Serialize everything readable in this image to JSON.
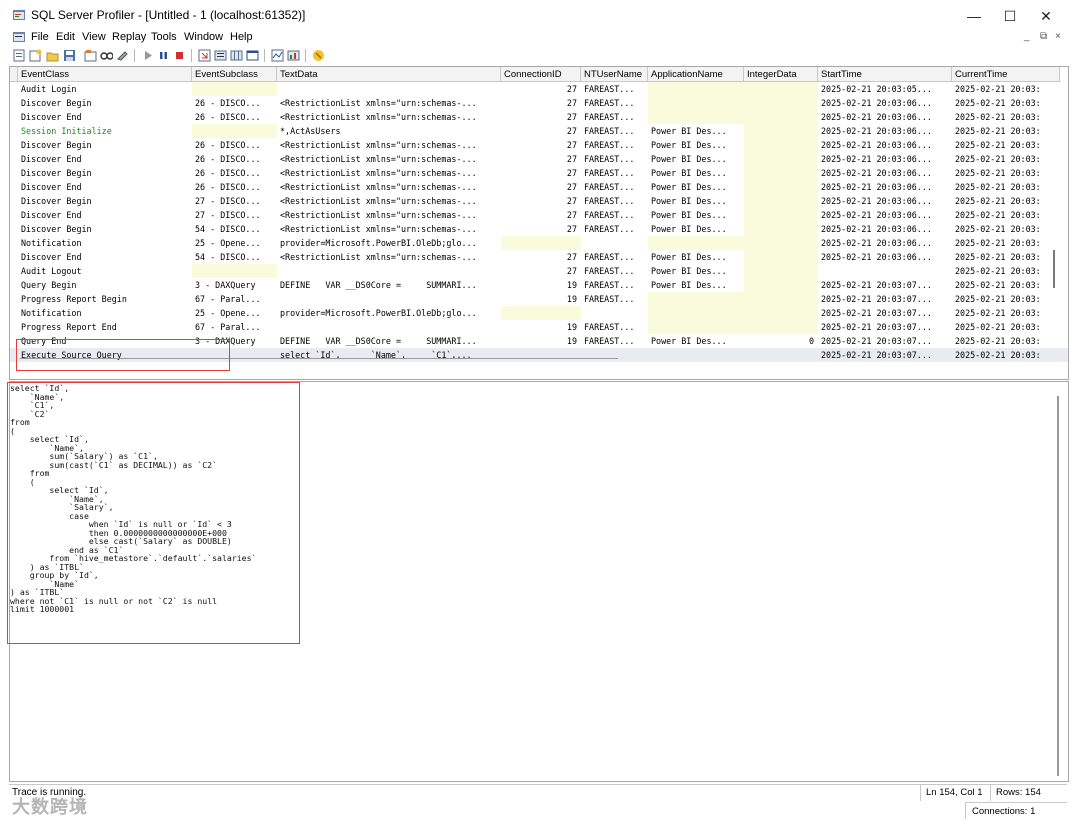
{
  "window": {
    "title": "SQL Server Profiler - [Untitled - 1 (localhost:61352)]",
    "minimize": "—",
    "maximize": "☐",
    "close": "✕"
  },
  "menu": {
    "items": [
      "File",
      "Edit",
      "View",
      "Replay",
      "Tools",
      "Window",
      "Help"
    ],
    "mdi_minimize": "_",
    "mdi_restore": "⧉",
    "mdi_close": "×"
  },
  "toolbar": {
    "icons": [
      "new-trace-icon",
      "new-template-icon",
      "open-icon",
      "save-icon",
      "properties-icon",
      "find-icon",
      "clear-icon",
      "start-icon",
      "pause-icon",
      "stop-icon",
      "scroll-icon",
      "columns-icon",
      "filter-icon",
      "window-icon",
      "perfmon-icon",
      "chart-icon",
      "help-icon"
    ]
  },
  "grid": {
    "columns": [
      "EventClass",
      "EventSubclass",
      "TextData",
      "ConnectionID",
      "NTUserName",
      "ApplicationName",
      "IntegerData",
      "StartTime",
      "CurrentTime"
    ],
    "rows": [
      [
        "Audit Login",
        "",
        "",
        "27",
        "FAREAST...",
        "",
        "",
        "2025-02-21 20:03:05...",
        "2025-02-21 20:03:"
      ],
      [
        "Discover Begin",
        "26 - DISCO...",
        "<RestrictionList xmlns=\"urn:schemas-...",
        "27",
        "FAREAST...",
        "",
        "",
        "2025-02-21 20:03:06...",
        "2025-02-21 20:03:"
      ],
      [
        "Discover End",
        "26 - DISCO...",
        "<RestrictionList xmlns=\"urn:schemas-...",
        "27",
        "FAREAST...",
        "",
        "",
        "2025-02-21 20:03:06...",
        "2025-02-21 20:03:"
      ],
      [
        "Session Initialize",
        "",
        "*,ActAsUsers",
        "27",
        "FAREAST...",
        "Power BI Des...",
        "",
        "2025-02-21 20:03:06...",
        "2025-02-21 20:03:"
      ],
      [
        "Discover Begin",
        "26 - DISCO...",
        "<RestrictionList xmlns=\"urn:schemas-...",
        "27",
        "FAREAST...",
        "Power BI Des...",
        "",
        "2025-02-21 20:03:06...",
        "2025-02-21 20:03:"
      ],
      [
        "Discover End",
        "26 - DISCO...",
        "<RestrictionList xmlns=\"urn:schemas-...",
        "27",
        "FAREAST...",
        "Power BI Des...",
        "",
        "2025-02-21 20:03:06...",
        "2025-02-21 20:03:"
      ],
      [
        "Discover Begin",
        "26 - DISCO...",
        "<RestrictionList xmlns=\"urn:schemas-...",
        "27",
        "FAREAST...",
        "Power BI Des...",
        "",
        "2025-02-21 20:03:06...",
        "2025-02-21 20:03:"
      ],
      [
        "Discover End",
        "26 - DISCO...",
        "<RestrictionList xmlns=\"urn:schemas-...",
        "27",
        "FAREAST...",
        "Power BI Des...",
        "",
        "2025-02-21 20:03:06...",
        "2025-02-21 20:03:"
      ],
      [
        "Discover Begin",
        "27 - DISCO...",
        "<RestrictionList xmlns=\"urn:schemas-...",
        "27",
        "FAREAST...",
        "Power BI Des...",
        "",
        "2025-02-21 20:03:06...",
        "2025-02-21 20:03:"
      ],
      [
        "Discover End",
        "27 - DISCO...",
        "<RestrictionList xmlns=\"urn:schemas-...",
        "27",
        "FAREAST...",
        "Power BI Des...",
        "",
        "2025-02-21 20:03:06...",
        "2025-02-21 20:03:"
      ],
      [
        "Discover Begin",
        "54 - DISCO...",
        "<RestrictionList xmlns=\"urn:schemas-...",
        "27",
        "FAREAST...",
        "Power BI Des...",
        "",
        "2025-02-21 20:03:06...",
        "2025-02-21 20:03:"
      ],
      [
        "Notification",
        "25 - Opene...",
        "provider=Microsoft.PowerBI.OleDb;glo...",
        "",
        "",
        "",
        "",
        "2025-02-21 20:03:06...",
        "2025-02-21 20:03:"
      ],
      [
        "Discover End",
        "54 - DISCO...",
        "<RestrictionList xmlns=\"urn:schemas-...",
        "27",
        "FAREAST...",
        "Power BI Des...",
        "",
        "2025-02-21 20:03:06...",
        "2025-02-21 20:03:"
      ],
      [
        "Audit Logout",
        "",
        "",
        "27",
        "FAREAST...",
        "Power BI Des...",
        "",
        "",
        "2025-02-21 20:03:"
      ],
      [
        "Query Begin",
        "3 - DAXQuery",
        "DEFINE   VAR __DS0Core =     SUMMARI...",
        "19",
        "FAREAST...",
        "Power BI Des...",
        "",
        "2025-02-21 20:03:07...",
        "2025-02-21 20:03:"
      ],
      [
        "Progress Report Begin",
        "67 - Paral...",
        "",
        "19",
        "FAREAST...",
        "",
        "",
        "2025-02-21 20:03:07...",
        "2025-02-21 20:03:"
      ],
      [
        "Notification",
        "25 - Opene...",
        "provider=Microsoft.PowerBI.OleDb;glo...",
        "",
        "",
        "",
        "",
        "2025-02-21 20:03:07...",
        "2025-02-21 20:03:"
      ],
      [
        "Progress Report End",
        "67 - Paral...",
        "",
        "19",
        "FAREAST...",
        "",
        "",
        "2025-02-21 20:03:07...",
        "2025-02-21 20:03:"
      ],
      [
        "Query End",
        "3 - DAXQuery",
        "DEFINE   VAR __DS0Core =     SUMMARI...",
        "19",
        "FAREAST...",
        "Power BI Des...",
        "0",
        "2025-02-21 20:03:07...",
        "2025-02-21 20:03:"
      ],
      [
        "Execute Source Query",
        "",
        "select `Id`,      `Name`,     `C1`,...",
        "",
        "",
        "",
        "",
        "2025-02-21 20:03:07...",
        "2025-02-21 20:03:"
      ]
    ]
  },
  "sql_text": "select `Id`,\n    `Name`,\n    `C1`,\n    `C2`\nfrom\n(\n    select `Id`,\n        `Name`,\n        sum(`Salary`) as `C1`,\n        sum(cast(`C1` as DECIMAL)) as `C2`\n    from\n    (\n        select `Id`,\n            `Name`,\n            `Salary`,\n            case\n                when `Id` is null or `Id` < 3\n                then 0.0000000000000000E+000\n                else cast(`Salary` as DOUBLE)\n            end as `C1`\n        from `hive_metastore`.`default`.`salaries`\n    ) as `ITBL`\n    group by `Id`,\n        `Name`\n) as `ITBL`\nwhere not `C1` is null or not `C2` is null\nlimit 1000001",
  "status": {
    "left": "Trace is running.",
    "position": "Ln 154, Col 1",
    "rows": "Rows: 154",
    "connections": "Connections: 1"
  },
  "watermark": "大数跨境",
  "colors": {
    "highlight_box": "#e53b3b",
    "session_text": "#1c8a1c",
    "cell_highlight": "#fafadc"
  }
}
